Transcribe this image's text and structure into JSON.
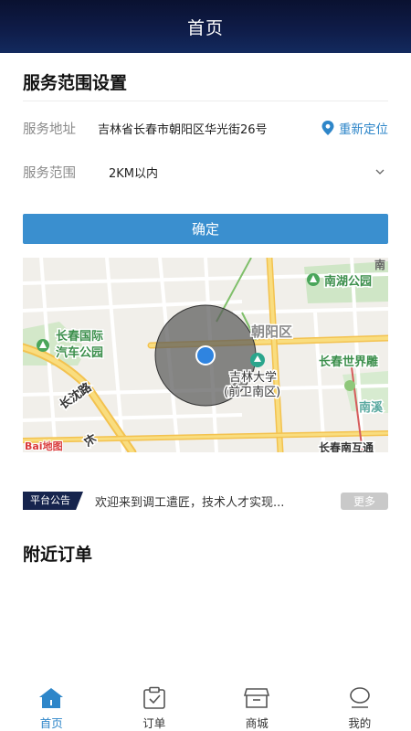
{
  "header": {
    "title": "首页"
  },
  "service": {
    "title": "服务范围设置",
    "address_label": "服务地址",
    "address_value": "吉林省长春市朝阳区华光街26号",
    "relocate_label": "重新定位",
    "range_label": "服务范围",
    "range_value": "2KM以内",
    "confirm_label": "确定"
  },
  "map": {
    "labels": {
      "nanhu_park": "南湖公园",
      "changchun_expo": "长春国际",
      "changchun_expo_2": "汽车公园",
      "chaoyang": "朝阳区",
      "jilin_univ": "吉林大学",
      "jilin_univ_2": "(前卫南区)",
      "world_sculpture": "长春世界雕",
      "changshen_road": "长沈路",
      "nanxi": "南溪",
      "changchun_nanhu": "长春南互通",
      "top_right": "南",
      "left_road": "长",
      "baidu": "Bai地图"
    }
  },
  "notice": {
    "badge": "平台公告",
    "text": "欢迎来到调工遣匠，技术人才实现...",
    "more_label": "更多"
  },
  "nearby": {
    "title": "附近订单"
  },
  "tabs": [
    {
      "label": "首页",
      "icon": "home-icon"
    },
    {
      "label": "订单",
      "icon": "order-icon"
    },
    {
      "label": "商城",
      "icon": "store-icon"
    },
    {
      "label": "我的",
      "icon": "profile-icon"
    }
  ],
  "colors": {
    "accent": "#2e86c9",
    "header": "#0f1d4a",
    "button": "#3a8fcf",
    "badge": "#16244d"
  }
}
